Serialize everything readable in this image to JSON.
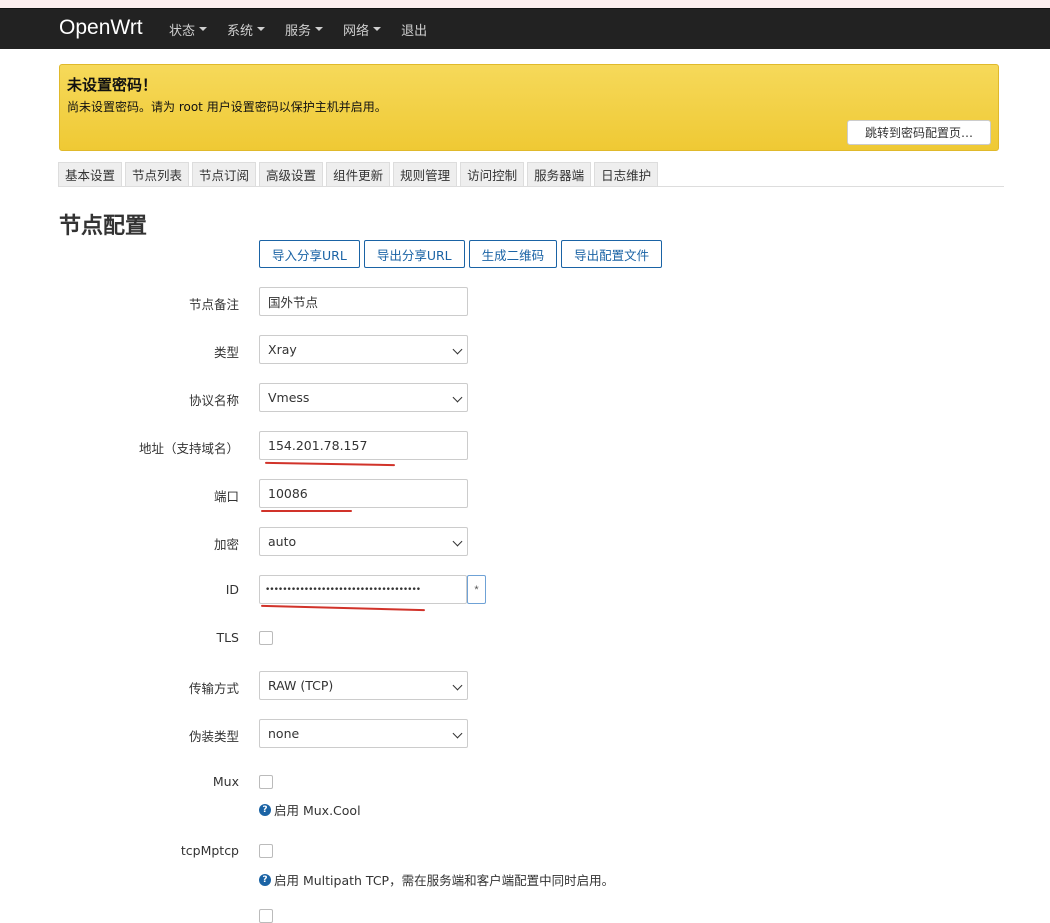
{
  "navbar": {
    "brand": "OpenWrt",
    "menu": [
      "状态",
      "系统",
      "服务",
      "网络",
      "退出"
    ]
  },
  "alert": {
    "title": "未设置密码！",
    "text": "尚未设置密码。请为 root 用户设置密码以保护主机并启用。",
    "button": "跳转到密码配置页…"
  },
  "tabs": [
    "基本设置",
    "节点列表",
    "节点订阅",
    "高级设置",
    "组件更新",
    "规则管理",
    "访问控制",
    "服务器端",
    "日志维护"
  ],
  "page": {
    "title": "节点配置",
    "buttons": [
      "导入分享URL",
      "导出分享URL",
      "生成二维码",
      "导出配置文件"
    ]
  },
  "form": {
    "remark": {
      "label": "节点备注",
      "value": "国外节点"
    },
    "type": {
      "label": "类型",
      "value": "Xray"
    },
    "protocol": {
      "label": "协议名称",
      "value": "Vmess"
    },
    "address": {
      "label": "地址（支持域名）",
      "value": "154.201.78.157"
    },
    "port": {
      "label": "端口",
      "value": "10086"
    },
    "encryption": {
      "label": "加密",
      "value": "auto"
    },
    "id": {
      "label": "ID",
      "value": "••••••••••••••••••••••••••••••••••••",
      "reveal": "*"
    },
    "tls": {
      "label": "TLS"
    },
    "transport": {
      "label": "传输方式",
      "value": "RAW (TCP)"
    },
    "header_type": {
      "label": "伪装类型",
      "value": "none"
    },
    "mux": {
      "label": "Mux",
      "help": "启用 Mux.Cool"
    },
    "tcp_mptcp": {
      "label": "tcpMptcp",
      "help": "启用 Multipath TCP，需在服务端和客户端配置中同时启用。"
    }
  },
  "colors": {
    "accent": "#1a63a5",
    "navbar": "#222222",
    "alert": "#f1cd3d",
    "annotation": "#d1332a"
  }
}
